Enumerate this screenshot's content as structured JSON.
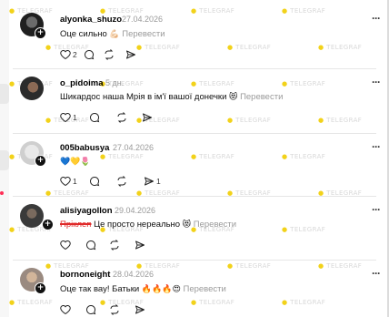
{
  "watermark": "TELEGRAF",
  "comments": [
    {
      "username": "alyonka_shuzo",
      "date": "27.04.2026",
      "text": "Оце сильно",
      "emoji": "💪🏻",
      "translate": "Перевести",
      "likes": "2",
      "replies": "",
      "reposts": ""
    },
    {
      "username": "o_pidoima",
      "date": "5 дн.",
      "text": "Шикардос наша Мрія в ім'ї вашої донечки",
      "emoji": "😻",
      "translate": "Перевести",
      "likes": "1",
      "replies": "",
      "reposts": ""
    },
    {
      "username": "005babusya",
      "date": "27.04.2026",
      "text": "",
      "emoji": "💙💛🌷",
      "translate": "",
      "likes": "1",
      "replies": "",
      "reposts": "1"
    },
    {
      "username": "alisiyagollon",
      "date": "29.04.2026",
      "struck_text": "Пріклеп",
      "text": "Це просто нереально",
      "emoji": "😻",
      "translate": "Перевести",
      "likes": "",
      "replies": "",
      "reposts": ""
    },
    {
      "username": "bornoneight",
      "date": "28.04.2026",
      "text": "Оце так вау! Батьки",
      "emoji": "🔥🔥🔥😍",
      "translate": "Перевести",
      "likes": "",
      "replies": "",
      "reposts": ""
    }
  ],
  "icons": {
    "like": "heart-icon",
    "reply": "comment-icon",
    "repost": "repost-icon",
    "share": "share-icon",
    "more": "more-icon",
    "follow": "plus-icon"
  }
}
